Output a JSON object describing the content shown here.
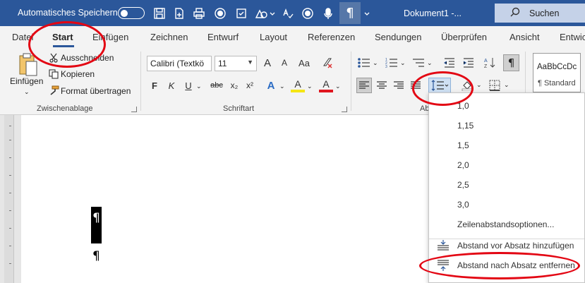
{
  "titlebar": {
    "autosave_label": "Automatisches Speichern",
    "document_title": "Dokument1  -...",
    "search_label": "Suchen",
    "brand_color": "#2b579a"
  },
  "tabs": [
    {
      "label": "Datei"
    },
    {
      "label": "Start"
    },
    {
      "label": "Einfügen"
    },
    {
      "label": "Zeichnen"
    },
    {
      "label": "Entwurf"
    },
    {
      "label": "Layout"
    },
    {
      "label": "Referenzen"
    },
    {
      "label": "Sendungen"
    },
    {
      "label": "Überprüfen"
    },
    {
      "label": "Ansicht"
    },
    {
      "label": "Entwic"
    }
  ],
  "ribbon": {
    "clipboard": {
      "paste_label": "Einfügen",
      "cut_label": "Ausschneiden",
      "copy_label": "Kopieren",
      "format_painter_label": "Format übertragen",
      "group_label": "Zwischenablage"
    },
    "font": {
      "font_name": "Calibri (Textkö",
      "font_size": "11",
      "grow_label": "A",
      "shrink_label": "A",
      "case_label": "Aa",
      "bold": "F",
      "italic": "K",
      "underline": "U",
      "strike": "abc",
      "subscript": "x₂",
      "superscript": "x²",
      "effects": "A",
      "highlight": "A",
      "font_color": "A",
      "group_label": "Schriftart"
    },
    "paragraph": {
      "group_label_partial": "Ab",
      "show_marks": "¶"
    },
    "styles": {
      "preview": "AaBbCcDc",
      "name": "¶ Standard"
    }
  },
  "document": {
    "pilcrow_selected": "¶",
    "pilcrow": "¶"
  },
  "spacing_menu": {
    "values": [
      "1,0",
      "1,15",
      "1,5",
      "2,0",
      "2,5",
      "3,0"
    ],
    "options_label": "Zeilenabstandsoptionen...",
    "add_before_label": "Abstand vor Absatz hinzufügen",
    "remove_after_label": "Abstand nach Absatz entfernen"
  },
  "annotations": {
    "highlight_color": "#e30613"
  }
}
